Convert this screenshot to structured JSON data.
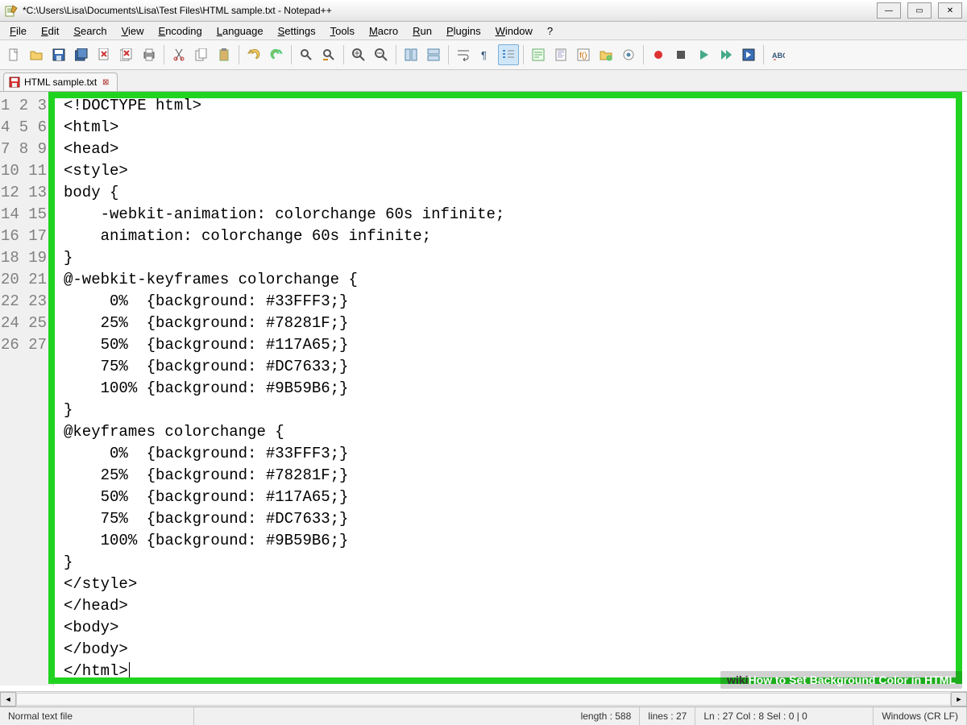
{
  "title": "*C:\\Users\\Lisa\\Documents\\Lisa\\Test Files\\HTML sample.txt - Notepad++",
  "menu": [
    "File",
    "Edit",
    "Search",
    "View",
    "Encoding",
    "Language",
    "Settings",
    "Tools",
    "Macro",
    "Run",
    "Plugins",
    "Window",
    "?"
  ],
  "toolbar_icons": [
    "new-file-icon",
    "open-file-icon",
    "save-icon",
    "save-all-icon",
    "close-icon",
    "close-all-icon",
    "print-icon",
    "|",
    "cut-icon",
    "copy-icon",
    "paste-icon",
    "|",
    "undo-icon",
    "redo-icon",
    "|",
    "find-icon",
    "replace-icon",
    "|",
    "zoom-in-icon",
    "zoom-out-icon",
    "|",
    "sync-v-icon",
    "sync-h-icon",
    "|",
    "wordwrap-icon",
    "show-all-chars-icon",
    "indent-guide-icon",
    "|",
    "udlv-icon",
    "doc-map-icon",
    "func-list-icon",
    "folder-workspace-icon",
    "monitoring-icon",
    "|",
    "record-macro-icon",
    "stop-macro-icon",
    "play-macro-icon",
    "play-multi-icon",
    "save-macro-icon",
    "|",
    "spellcheck-icon"
  ],
  "toolbar_active": "indent-guide-icon",
  "tab": {
    "label": "HTML sample.txt",
    "modified": true
  },
  "lines": [
    "<!DOCTYPE html>",
    "<html>",
    "<head>",
    "<style>",
    "body {",
    "    -webkit-animation: colorchange 60s infinite;",
    "    animation: colorchange 60s infinite;",
    "}",
    "@-webkit-keyframes colorchange {",
    "     0%  {background: #33FFF3;}",
    "    25%  {background: #78281F;}",
    "    50%  {background: #117A65;}",
    "    75%  {background: #DC7633;}",
    "    100% {background: #9B59B6;}",
    "}",
    "@keyframes colorchange {",
    "     0%  {background: #33FFF3;}",
    "    25%  {background: #78281F;}",
    "    50%  {background: #117A65;}",
    "    75%  {background: #DC7633;}",
    "    100% {background: #9B59B6;}",
    "}",
    "</style>",
    "</head>",
    "<body>",
    "</body>",
    "</html>"
  ],
  "status": {
    "filetype": "Normal text file",
    "length": "length : 588",
    "lines": "lines : 27",
    "pos": "Ln : 27   Col : 8   Sel : 0 | 0",
    "eol": "Windows (CR LF)"
  },
  "watermark_prefix": "wiki",
  "watermark_text": "How to Set Background Color in HTML"
}
